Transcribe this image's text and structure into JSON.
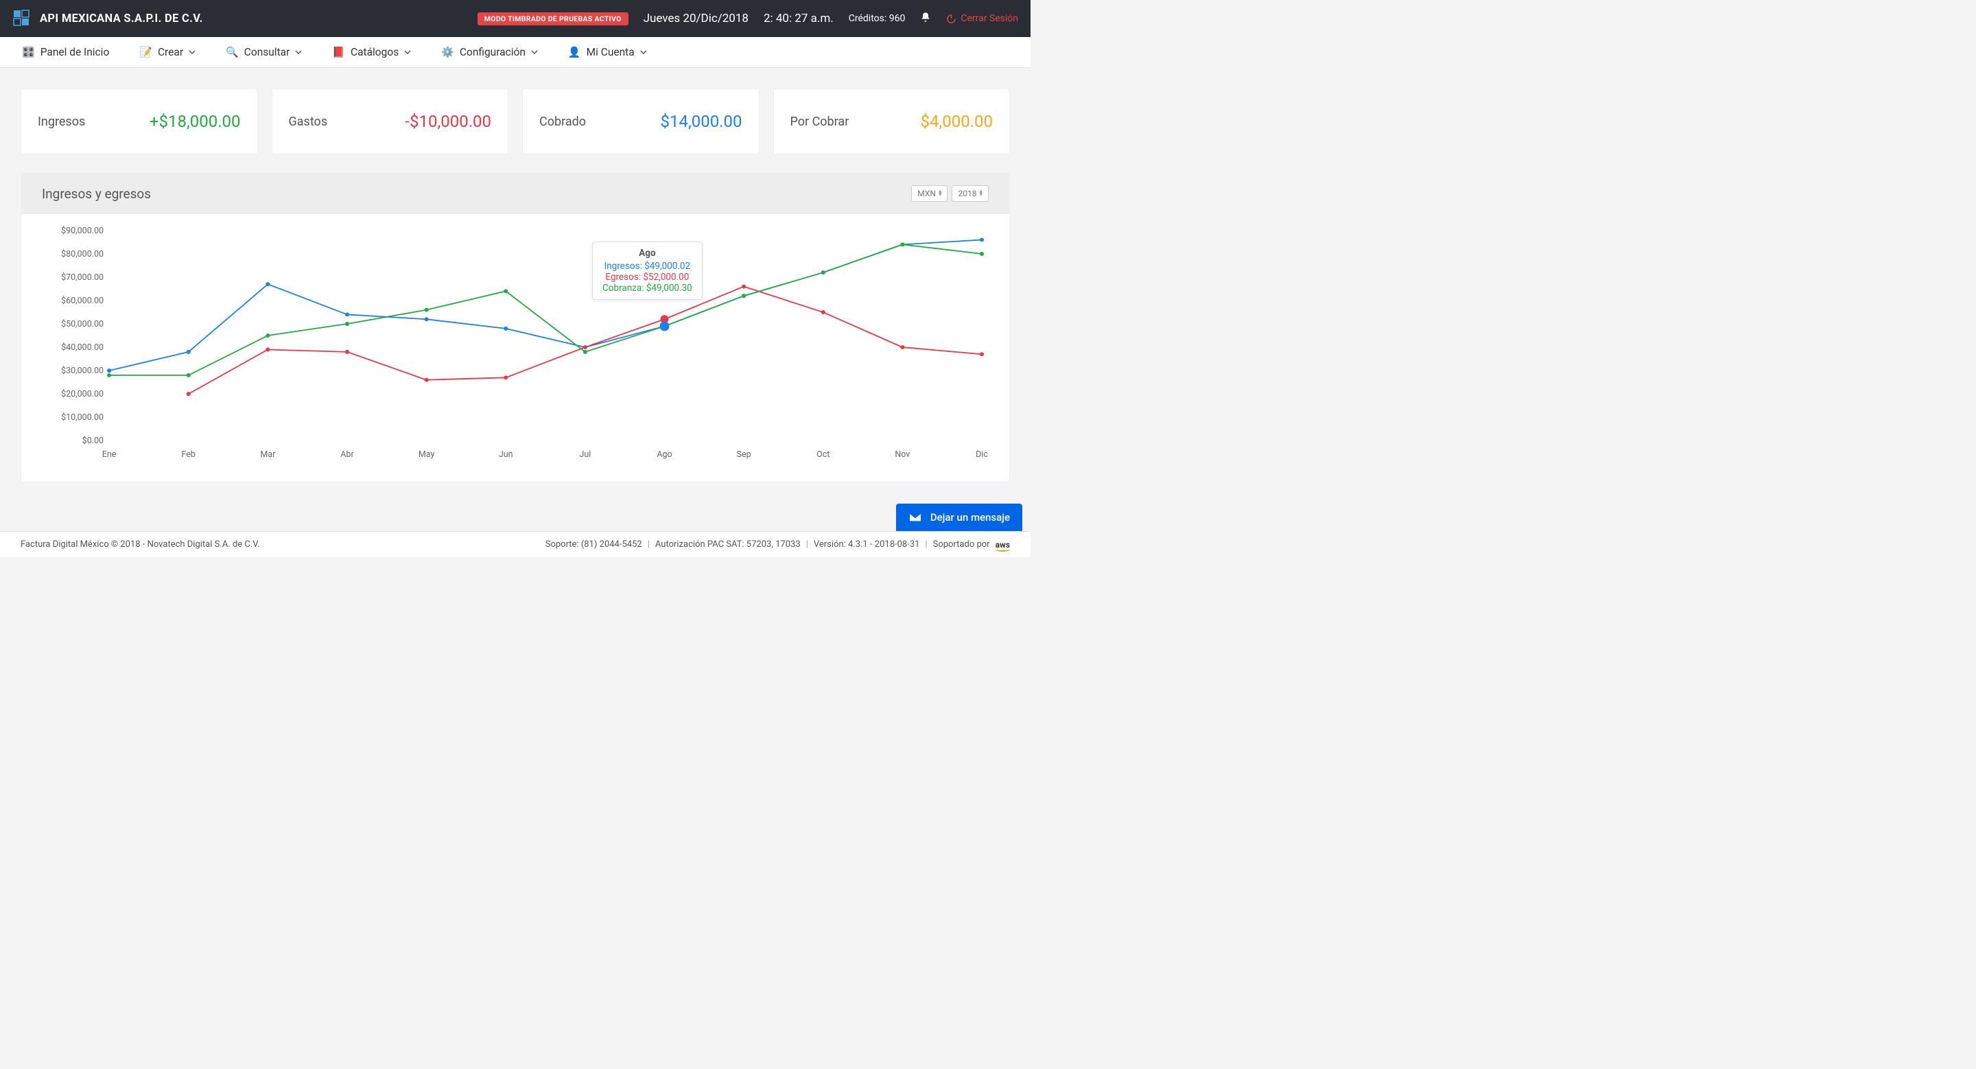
{
  "header": {
    "company": "API MEXICANA S.A.P.I. DE C.V.",
    "badge": "MODO TIMBRADO DE PRUEBAS ACTIVO",
    "date": "Jueves 20/Dic/2018",
    "time": "2: 40: 27 a.m.",
    "credits": "Créditos: 960",
    "logout": "Cerrar Sesión"
  },
  "nav": {
    "home": "Panel de Inicio",
    "create": "Crear",
    "consult": "Consultar",
    "catalogs": "Catálogos",
    "config": "Configuración",
    "account": "Mi Cuenta"
  },
  "cards": {
    "ingresos": {
      "label": "Ingresos",
      "value": "+$18,000.00"
    },
    "gastos": {
      "label": "Gastos",
      "value": "-$10,000.00"
    },
    "cobrado": {
      "label": "Cobrado",
      "value": "$14,000.00"
    },
    "porcobrar": {
      "label": "Por Cobrar",
      "value": "$4,000.00"
    }
  },
  "chart": {
    "title": "Ingresos y egresos",
    "currency": "MXN",
    "year": "2018",
    "tooltip": {
      "month": "Ago",
      "ingresos": "Ingresos: $49,000.02",
      "egresos": "Egresos: $52,000.00",
      "cobranza": "Cobranza: $49,000.30"
    }
  },
  "chart_data": {
    "type": "line",
    "categories": [
      "Ene",
      "Feb",
      "Mar",
      "Abr",
      "May",
      "Jun",
      "Jul",
      "Ago",
      "Sep",
      "Oct",
      "Nov",
      "Dic"
    ],
    "series": [
      {
        "name": "Ingresos",
        "color": "#1e7fe6",
        "values": [
          30000,
          38000,
          67000,
          54000,
          52000,
          48000,
          40000,
          49000.02,
          62000,
          72000,
          84000,
          86000
        ]
      },
      {
        "name": "Egresos",
        "color": "#e63946",
        "values": [
          null,
          20000,
          39000,
          38000,
          26000,
          27000,
          40000,
          52000,
          66000,
          55000,
          40000,
          37000
        ]
      },
      {
        "name": "Cobranza",
        "color": "#28a745",
        "values": [
          28000,
          28000,
          45000,
          50000,
          56000,
          64000,
          38000,
          49000.3,
          62000,
          72000,
          84000,
          80000
        ]
      }
    ],
    "ylabels": [
      "$0.00",
      "$10,000.00",
      "$20,000.00",
      "$30,000.00",
      "$40,000.00",
      "$50,000.00",
      "$60,000.00",
      "$70,000.00",
      "$80,000.00",
      "$90,000.00"
    ],
    "ylim": [
      0,
      90000
    ]
  },
  "footer": {
    "left": "Factura Digital México © 2018 - Novatech Digital S.A. de C.V.",
    "support": "Soporte: (81) 2044-5452",
    "auth": "Autorización PAC SAT: 57203, 17033",
    "version": "Versión: 4.3.1 - 2018-08-31",
    "hosted": "Soportado por",
    "aws": "aws"
  },
  "chat": "Dejar un mensaje"
}
